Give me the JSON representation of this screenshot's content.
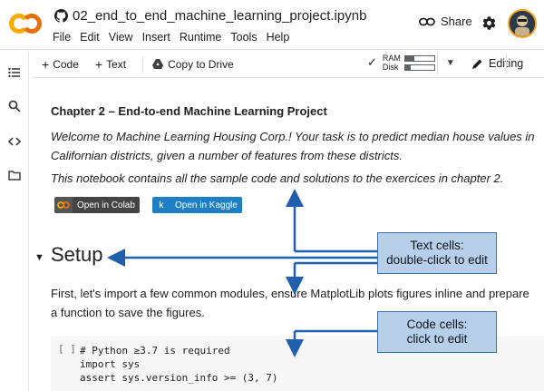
{
  "app": {
    "logo_text": "CO",
    "notebook_title": "02_end_to_end_machine_learning_project.ipynb",
    "menu": [
      "File",
      "Edit",
      "View",
      "Insert",
      "Runtime",
      "Tools",
      "Help"
    ],
    "share_label": "Share",
    "accent": "#f9ab00"
  },
  "toolbar": {
    "code_label": "Code",
    "text_label": "Text",
    "copy_drive_label": "Copy to Drive",
    "ram_label": "RAM",
    "disk_label": "Disk",
    "ram_fill": 0.3,
    "disk_fill": 0.2,
    "editing_label": "Editing"
  },
  "notebook": {
    "chapter_title": "Chapter 2 – End-to-end Machine Learning Project",
    "intro_line1": "Welcome to Machine Learning Housing Corp.! Your task is to predict median house values in",
    "intro_line2": "Californian districts, given a number of features from these districts.",
    "intro_para2": "This notebook contains all the sample code and solutions to the exercices in chapter 2.",
    "badge_colab": "Open in Colab",
    "badge_kaggle": "Open in Kaggle",
    "setup_heading": "Setup",
    "setup_line1": "First, let's import a few common modules, ensure MatplotLib plots figures inline and prepare",
    "setup_line2": "a function to save the figures.",
    "code_run_bracket": "[ ]",
    "code_lines": [
      "# Python ≥3.7 is required",
      "import sys",
      "assert sys.version_info >= (3, 7)"
    ]
  },
  "callouts": {
    "text_cells_line1": "Text cells:",
    "text_cells_line2": "double-click to edit",
    "code_cells_line1": "Code cells:",
    "code_cells_line2": "click to edit",
    "color": "#1f5fae"
  }
}
